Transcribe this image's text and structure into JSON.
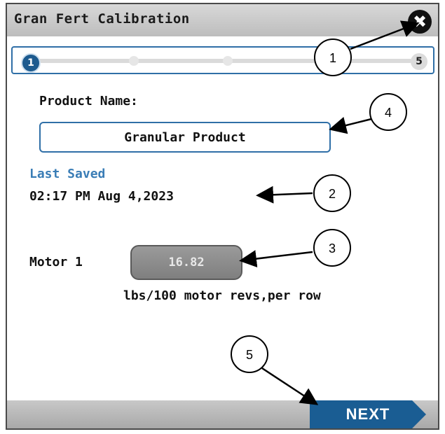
{
  "title": "Gran Fert Calibration",
  "close_icon": "close-icon",
  "progress": {
    "current_step": "1",
    "last_step": "5",
    "total_steps": 5
  },
  "product_name": {
    "label": "Product Name:",
    "value": "Granular Product"
  },
  "last_saved": {
    "label": "Last Saved",
    "timestamp": "02:17 PM Aug  4,2023"
  },
  "motor": {
    "label": "Motor 1",
    "value": "16.82",
    "units": "lbs/100 motor revs,per row"
  },
  "next_label": "NEXT",
  "callouts": [
    "1",
    "2",
    "3",
    "4",
    "5"
  ],
  "colors": {
    "accent": "#1a5d93",
    "link": "#3a7db6",
    "border": "#2f6fa7"
  }
}
